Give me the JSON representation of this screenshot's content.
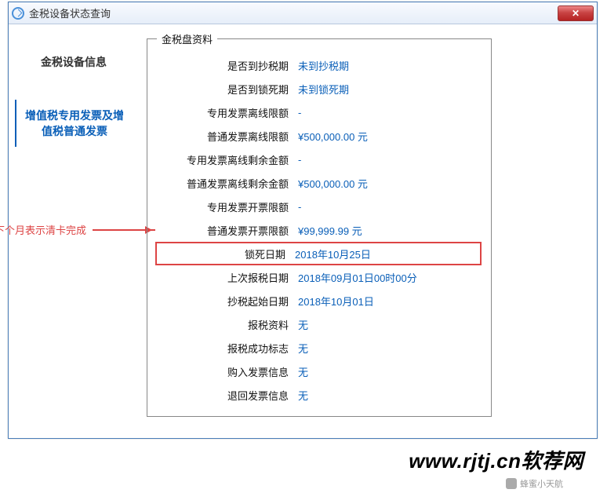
{
  "window": {
    "title": "金税设备状态查询"
  },
  "sidebar": {
    "items": [
      {
        "label": "金税设备信息"
      },
      {
        "label": "增值税专用发票及增值税普通发票"
      }
    ],
    "active_index": 1
  },
  "group": {
    "title": "金税盘资料",
    "rows": [
      {
        "label": "是否到抄税期",
        "value": "未到抄税期"
      },
      {
        "label": "是否到锁死期",
        "value": "未到锁死期"
      },
      {
        "label": "专用发票离线限额",
        "value": "-"
      },
      {
        "label": "普通发票离线限额",
        "value": "¥500,000.00 元"
      },
      {
        "label": "专用发票离线剩余金额",
        "value": "-"
      },
      {
        "label": "普通发票离线剩余金额",
        "value": "¥500,000.00 元"
      },
      {
        "label": "专用发票开票限额",
        "value": "-"
      },
      {
        "label": "普通发票开票限额",
        "value": "¥99,999.99 元"
      },
      {
        "label": "锁死日期",
        "value": "2018年10月25日",
        "highlight": true
      },
      {
        "label": "上次报税日期",
        "value": "2018年09月01日00时00分"
      },
      {
        "label": "抄税起始日期",
        "value": "2018年10月01日"
      },
      {
        "label": "报税资料",
        "value": "无"
      },
      {
        "label": "报税成功标志",
        "value": "无"
      },
      {
        "label": "购入发票信息",
        "value": "无"
      },
      {
        "label": "退回发票信息",
        "value": "无"
      }
    ]
  },
  "annotation": "锁死日期变为下个月表示清卡完成",
  "watermark": "www.rjtj.cn软荐网",
  "wechat_tag": "蜂蜜小天航"
}
